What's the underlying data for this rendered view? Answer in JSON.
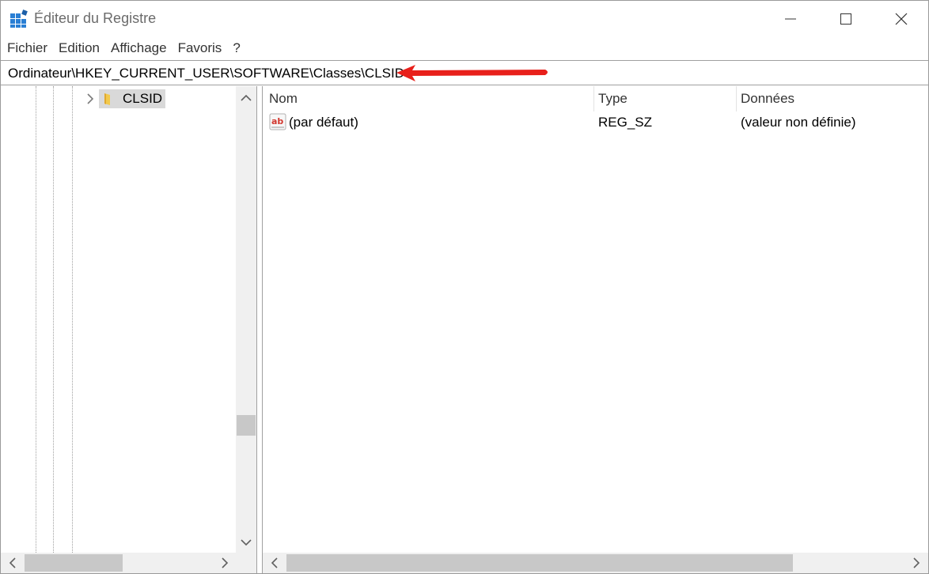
{
  "window": {
    "title": "Éditeur du Registre"
  },
  "menu": {
    "items": [
      "Fichier",
      "Edition",
      "Affichage",
      "Favoris",
      "?"
    ]
  },
  "address": {
    "path": "Ordinateur\\HKEY_CURRENT_USER\\SOFTWARE\\Classes\\CLSID"
  },
  "tree": {
    "selected_key": "CLSID"
  },
  "values": {
    "columns": [
      "Nom",
      "Type",
      "Données"
    ],
    "rows": [
      {
        "name": "(par défaut)",
        "type": "REG_SZ",
        "data": "(valeur non définie)",
        "icon": "string-value-icon"
      }
    ]
  },
  "colors": {
    "annotation_arrow": "#e8201b",
    "selection": "#d9d9d9"
  }
}
